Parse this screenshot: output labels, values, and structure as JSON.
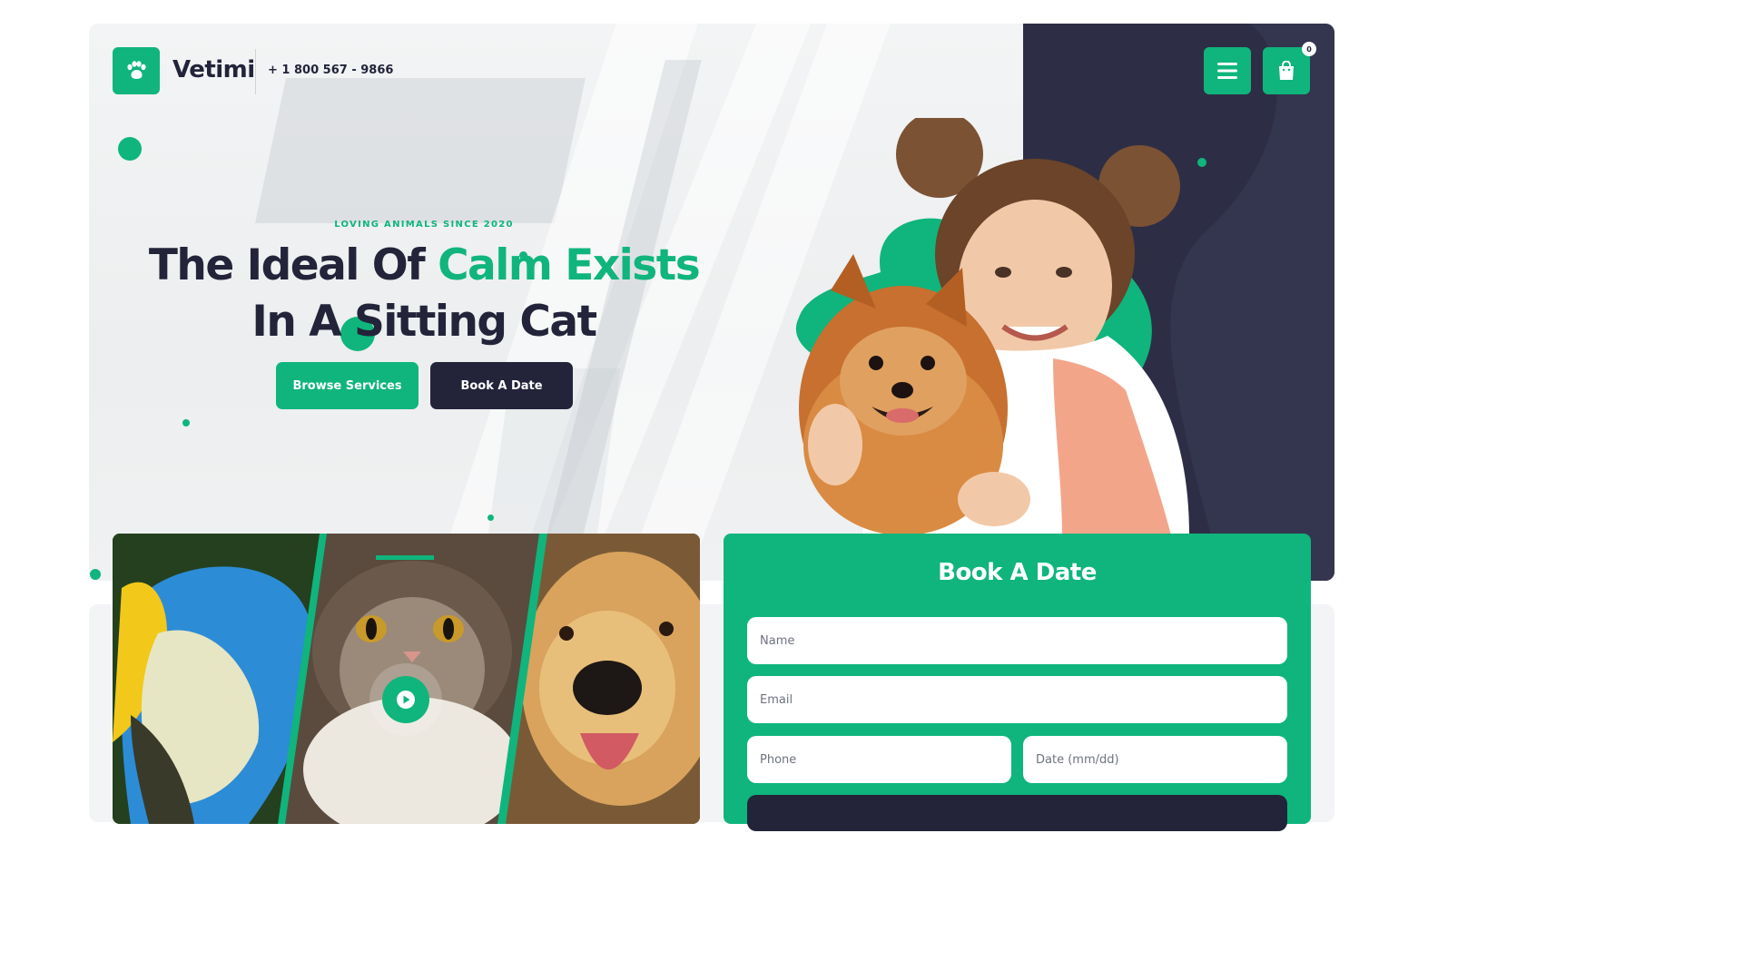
{
  "header": {
    "brand": "Vetimi",
    "phone": "+ 1 800 567 - 9866",
    "cart_count": "0"
  },
  "hero": {
    "tagline": "LOVING ANIMALS SINCE 2020",
    "headline_part1": "The Ideal Of ",
    "headline_accent": "Calm Exists",
    "headline_part2": " In A Sitting Cat",
    "browse_label": "Browse Services",
    "book_label": "Book A Date"
  },
  "form": {
    "title": "Book A Date",
    "name_placeholder": "Name",
    "email_placeholder": "Email",
    "phone_placeholder": "Phone",
    "date_placeholder": "Date (mm/dd)"
  },
  "colors": {
    "accent": "#0fb57c",
    "navy": "#23243a"
  },
  "icons": [
    "paw-icon",
    "menu-icon",
    "shopping-bag-icon",
    "play-icon"
  ]
}
